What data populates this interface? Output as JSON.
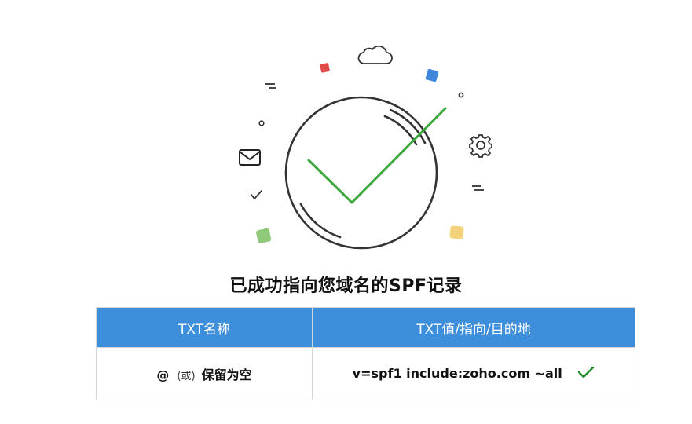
{
  "success_title": "已成功指向您域名的SPF记录",
  "table": {
    "headers": [
      "TXT名称",
      "TXT值/指向/目的地"
    ],
    "row": {
      "name_symbol": "@",
      "name_or": "(或)",
      "name_text": "保留为空",
      "value": "v=spf1 include:zoho.com ~all"
    }
  },
  "icons": [
    "check-circle-icon",
    "cloud-icon",
    "envelope-icon",
    "gear-icon",
    "small-check-icon",
    "verified-check-icon"
  ],
  "colors": {
    "accent_blue": "#3d8edb",
    "check_green": "#3aa83a",
    "verified_green": "#1f8a2a",
    "confetti_red": "#e24a4a",
    "confetti_blue": "#3f86dd",
    "confetti_green": "#8fc97a",
    "confetti_yellow": "#f2d27a"
  }
}
